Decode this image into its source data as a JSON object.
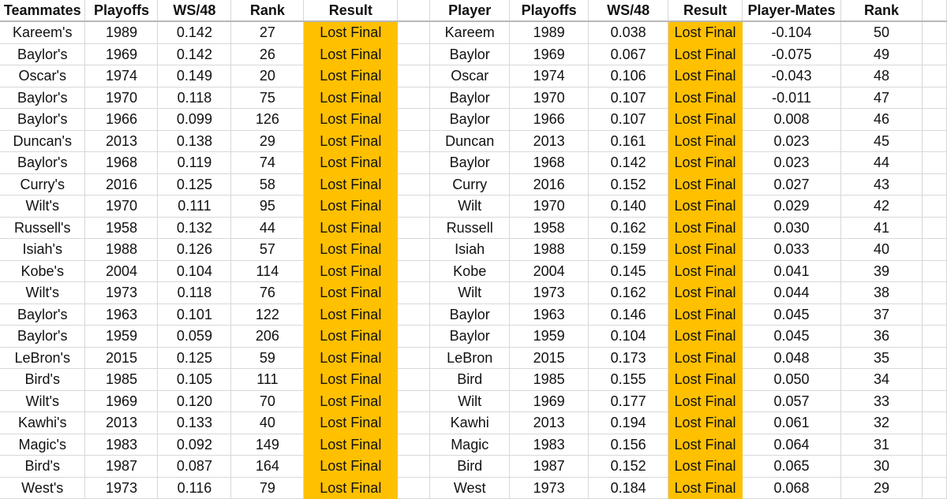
{
  "left_table": {
    "headers": [
      "Teammates",
      "Playoffs",
      "WS/48",
      "Rank",
      "Result"
    ],
    "rows": [
      [
        "Kareem's",
        "1989",
        "0.142",
        "27",
        "Lost Final"
      ],
      [
        "Baylor's",
        "1969",
        "0.142",
        "26",
        "Lost Final"
      ],
      [
        "Oscar's",
        "1974",
        "0.149",
        "20",
        "Lost Final"
      ],
      [
        "Baylor's",
        "1970",
        "0.118",
        "75",
        "Lost Final"
      ],
      [
        "Baylor's",
        "1966",
        "0.099",
        "126",
        "Lost Final"
      ],
      [
        "Duncan's",
        "2013",
        "0.138",
        "29",
        "Lost Final"
      ],
      [
        "Baylor's",
        "1968",
        "0.119",
        "74",
        "Lost Final"
      ],
      [
        "Curry's",
        "2016",
        "0.125",
        "58",
        "Lost Final"
      ],
      [
        "Wilt's",
        "1970",
        "0.111",
        "95",
        "Lost Final"
      ],
      [
        "Russell's",
        "1958",
        "0.132",
        "44",
        "Lost Final"
      ],
      [
        "Isiah's",
        "1988",
        "0.126",
        "57",
        "Lost Final"
      ],
      [
        "Kobe's",
        "2004",
        "0.104",
        "114",
        "Lost Final"
      ],
      [
        "Wilt's",
        "1973",
        "0.118",
        "76",
        "Lost Final"
      ],
      [
        "Baylor's",
        "1963",
        "0.101",
        "122",
        "Lost Final"
      ],
      [
        "Baylor's",
        "1959",
        "0.059",
        "206",
        "Lost Final"
      ],
      [
        "LeBron's",
        "2015",
        "0.125",
        "59",
        "Lost Final"
      ],
      [
        "Bird's",
        "1985",
        "0.105",
        "111",
        "Lost Final"
      ],
      [
        "Wilt's",
        "1969",
        "0.120",
        "70",
        "Lost Final"
      ],
      [
        "Kawhi's",
        "2013",
        "0.133",
        "40",
        "Lost Final"
      ],
      [
        "Magic's",
        "1983",
        "0.092",
        "149",
        "Lost Final"
      ],
      [
        "Bird's",
        "1987",
        "0.087",
        "164",
        "Lost Final"
      ],
      [
        "West's",
        "1973",
        "0.116",
        "79",
        "Lost Final"
      ]
    ]
  },
  "right_table": {
    "headers": [
      "Player",
      "Playoffs",
      "WS/48",
      "Result",
      "Player-Mates",
      "Rank"
    ],
    "rows": [
      [
        "Kareem",
        "1989",
        "0.038",
        "Lost Final",
        "-0.104",
        "50"
      ],
      [
        "Baylor",
        "1969",
        "0.067",
        "Lost Final",
        "-0.075",
        "49"
      ],
      [
        "Oscar",
        "1974",
        "0.106",
        "Lost Final",
        "-0.043",
        "48"
      ],
      [
        "Baylor",
        "1970",
        "0.107",
        "Lost Final",
        "-0.011",
        "47"
      ],
      [
        "Baylor",
        "1966",
        "0.107",
        "Lost Final",
        "0.008",
        "46"
      ],
      [
        "Duncan",
        "2013",
        "0.161",
        "Lost Final",
        "0.023",
        "45"
      ],
      [
        "Baylor",
        "1968",
        "0.142",
        "Lost Final",
        "0.023",
        "44"
      ],
      [
        "Curry",
        "2016",
        "0.152",
        "Lost Final",
        "0.027",
        "43"
      ],
      [
        "Wilt",
        "1970",
        "0.140",
        "Lost Final",
        "0.029",
        "42"
      ],
      [
        "Russell",
        "1958",
        "0.162",
        "Lost Final",
        "0.030",
        "41"
      ],
      [
        "Isiah",
        "1988",
        "0.159",
        "Lost Final",
        "0.033",
        "40"
      ],
      [
        "Kobe",
        "2004",
        "0.145",
        "Lost Final",
        "0.041",
        "39"
      ],
      [
        "Wilt",
        "1973",
        "0.162",
        "Lost Final",
        "0.044",
        "38"
      ],
      [
        "Baylor",
        "1963",
        "0.146",
        "Lost Final",
        "0.045",
        "37"
      ],
      [
        "Baylor",
        "1959",
        "0.104",
        "Lost Final",
        "0.045",
        "36"
      ],
      [
        "LeBron",
        "2015",
        "0.173",
        "Lost Final",
        "0.048",
        "35"
      ],
      [
        "Bird",
        "1985",
        "0.155",
        "Lost Final",
        "0.050",
        "34"
      ],
      [
        "Wilt",
        "1969",
        "0.177",
        "Lost Final",
        "0.057",
        "33"
      ],
      [
        "Kawhi",
        "2013",
        "0.194",
        "Lost Final",
        "0.061",
        "32"
      ],
      [
        "Magic",
        "1983",
        "0.156",
        "Lost Final",
        "0.064",
        "31"
      ],
      [
        "Bird",
        "1987",
        "0.152",
        "Lost Final",
        "0.065",
        "30"
      ],
      [
        "West",
        "1973",
        "0.184",
        "Lost Final",
        "0.068",
        "29"
      ]
    ]
  },
  "colors": {
    "result_highlight": "#ffc000",
    "gridline": "#d8d8d8"
  }
}
